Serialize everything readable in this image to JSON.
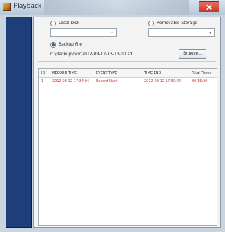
{
  "window": {
    "title": "Playback"
  },
  "source_options": {
    "local_disk_label": "Local Disk",
    "removable_storage_label": "Removable Storage",
    "backup_file_label": "Backup File",
    "selected": "backup_file"
  },
  "backup": {
    "path": "C:\\Backup\\dev\\2012-08-12-13-13-00.sd",
    "browse_label": "Browse..."
  },
  "table": {
    "columns": [
      "ID",
      "RECORD TIME",
      "EVENT TYPE",
      "TIME END",
      "Total Times"
    ],
    "rows": [
      {
        "id": "1",
        "record_time": "2012-08-12 17:34:04",
        "event_type": "Record Start",
        "time_end": "2012-08-12 17:50:24",
        "total_times": "00:16:20"
      }
    ]
  }
}
